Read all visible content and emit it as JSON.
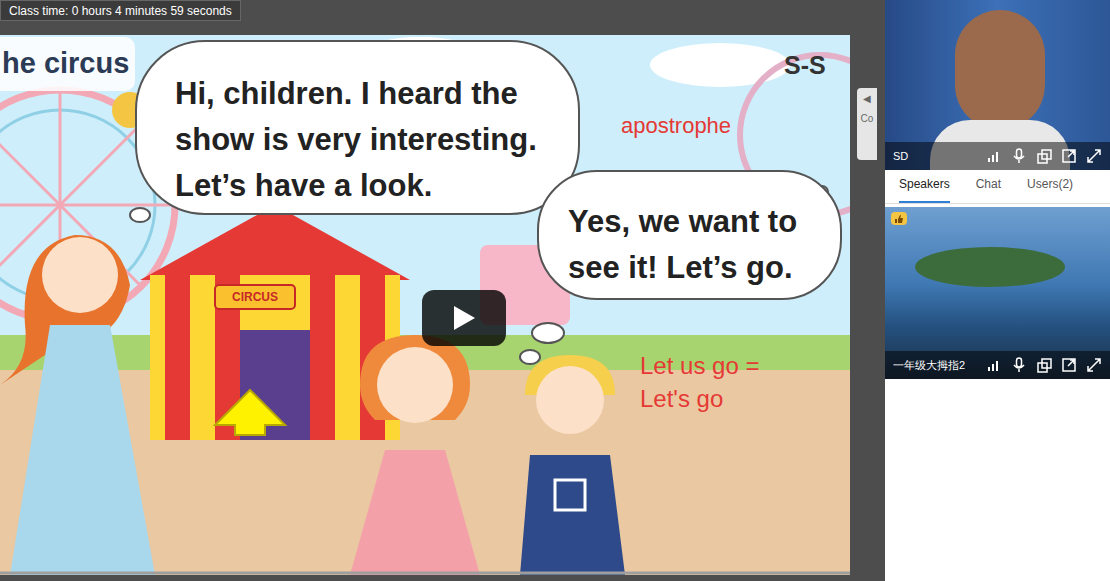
{
  "header": {
    "class_time": "Class time: 0 hours 4 minutes 59 seconds"
  },
  "slide": {
    "title": "he circus",
    "corner_label": "S-S",
    "bubbles": [
      {
        "lines": [
          "Hi, children. I heard the",
          "show is very interesting.",
          "Let’s have a look."
        ]
      },
      {
        "lines": [
          "Yes, we want to",
          "see it! Let’s go."
        ]
      }
    ],
    "apostrophe_note": "apostrophe",
    "contraction_note": [
      "Let us go =",
      "Let's go"
    ],
    "tent_sign": "CIRCUS"
  },
  "side_tab": {
    "arrow": "◀",
    "label": "Co"
  },
  "teacher_video": {
    "name": "SD"
  },
  "tabs": [
    {
      "label": "Speakers",
      "selected": true
    },
    {
      "label": "Chat",
      "selected": false
    },
    {
      "label": "Users(2)",
      "selected": false
    }
  ],
  "class_video": {
    "name": "一年级大拇指2"
  }
}
